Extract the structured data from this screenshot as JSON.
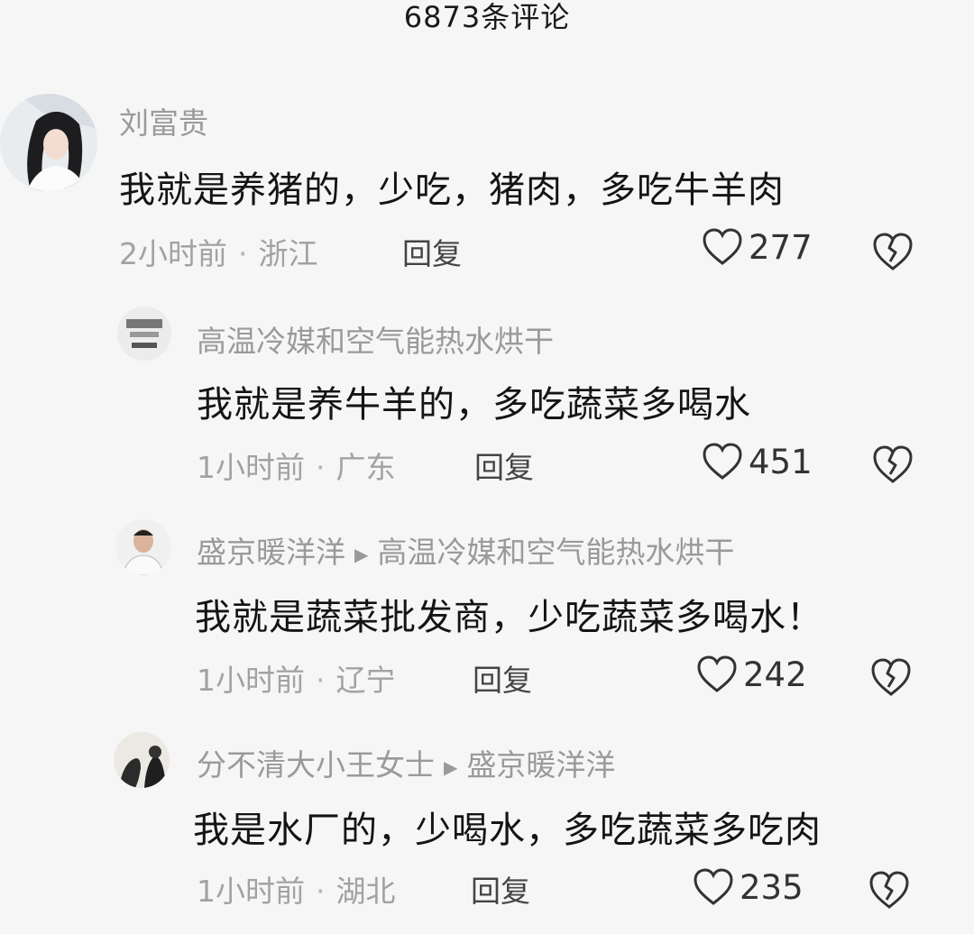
{
  "header": {
    "title": "6873条评论"
  },
  "comments": [
    {
      "username": "刘富贵",
      "text": "我就是养猪的，少吃，猪肉，多吃牛羊肉",
      "time": "2小时前",
      "location": "浙江",
      "reply_label": "回复",
      "likes": "277"
    },
    {
      "username": "高温冷媒和空气能热水烘干",
      "text": "我就是养牛羊的，多吃蔬菜多喝水",
      "time": "1小时前",
      "location": "广东",
      "reply_label": "回复",
      "likes": "451"
    },
    {
      "username": "盛京暖洋洋",
      "reply_to": "高温冷媒和空气能热水烘干",
      "text": "我就是蔬菜批发商，少吃蔬菜多喝水！",
      "time": "1小时前",
      "location": "辽宁",
      "reply_label": "回复",
      "likes": "242"
    },
    {
      "username": "分不清大小王女士",
      "reply_to": "盛京暖洋洋",
      "text": "我是水厂的，少喝水，多吃蔬菜多吃肉",
      "time": "1小时前",
      "location": "湖北",
      "reply_label": "回复",
      "likes": "235"
    }
  ],
  "icons": {
    "like": "heart-outline-icon",
    "dislike": "broken-heart-icon",
    "reply_arrow": "triangle-right-icon"
  },
  "colors": {
    "background": "#f6f6f6",
    "secondary_text": "#9a9a9a",
    "primary_text": "#141414"
  }
}
